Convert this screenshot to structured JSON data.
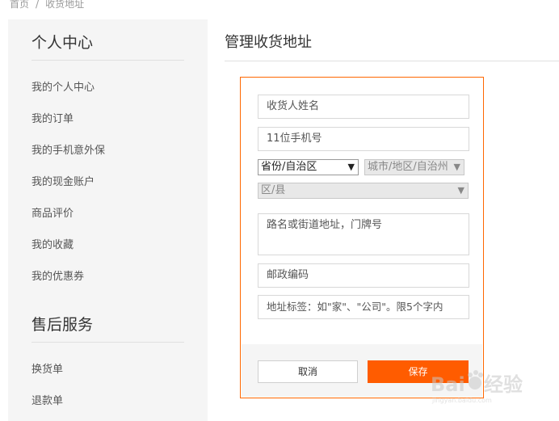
{
  "breadcrumb": {
    "home": "首页",
    "separator": "/",
    "current": "收货地址"
  },
  "sidebar": {
    "sections": [
      {
        "title": "个人中心",
        "items": [
          "我的个人中心",
          "我的订单",
          "我的手机意外保",
          "我的现金账户",
          "商品评价",
          "我的收藏",
          "我的优惠券"
        ]
      },
      {
        "title": "售后服务",
        "items": [
          "换货单",
          "退款单"
        ]
      }
    ]
  },
  "page": {
    "title": "管理收货地址"
  },
  "form": {
    "name_placeholder": "收货人姓名",
    "phone_placeholder": "11位手机号",
    "province_select": "省份/自治区",
    "city_select": "城市/地区/自治州",
    "district_select": "区/县",
    "street_placeholder": "路名或街道地址，门牌号",
    "zip_placeholder": "邮政编码",
    "tag_placeholder": "地址标签：如\"家\"、\"公司\"。限5个字内",
    "cancel_label": "取消",
    "save_label": "保存"
  },
  "colors": {
    "accent": "#ff6700",
    "sidebar_bg": "#f5f5f5"
  }
}
